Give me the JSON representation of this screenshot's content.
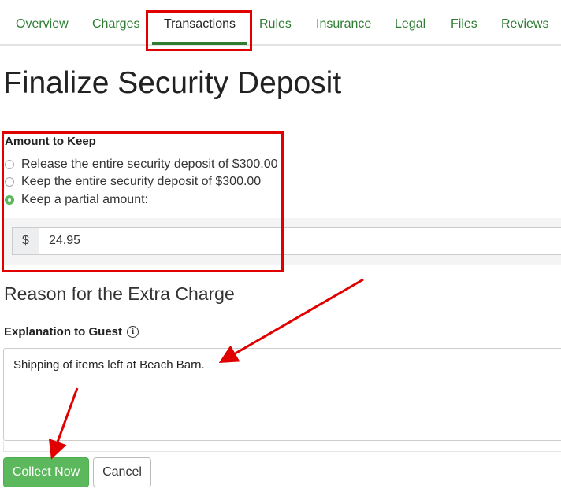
{
  "tabs": [
    {
      "label": "Overview"
    },
    {
      "label": "Charges"
    },
    {
      "label": "Transactions"
    },
    {
      "label": "Rules"
    },
    {
      "label": "Insurance"
    },
    {
      "label": "Legal"
    },
    {
      "label": "Files"
    },
    {
      "label": "Reviews"
    }
  ],
  "active_tab": "Transactions",
  "page": {
    "title": "Finalize Security Deposit"
  },
  "amount": {
    "label": "Amount to Keep",
    "options": [
      {
        "label": "Release the entire security deposit of $300.00",
        "selected": false
      },
      {
        "label": "Keep the entire security deposit of $300.00",
        "selected": false
      },
      {
        "label": "Keep a partial amount:",
        "selected": true
      }
    ],
    "currency_symbol": "$",
    "value": "24.95"
  },
  "reason": {
    "heading": "Reason for the Extra Charge",
    "label": "Explanation to Guest",
    "info_glyph": "i",
    "text": "Shipping of items left at Beach Barn."
  },
  "actions": {
    "collect_label": "Collect Now",
    "cancel_label": "Cancel"
  },
  "colors": {
    "accent_green": "#2e7d32",
    "button_green": "#5cb85c",
    "annotation_red": "#e10000"
  }
}
